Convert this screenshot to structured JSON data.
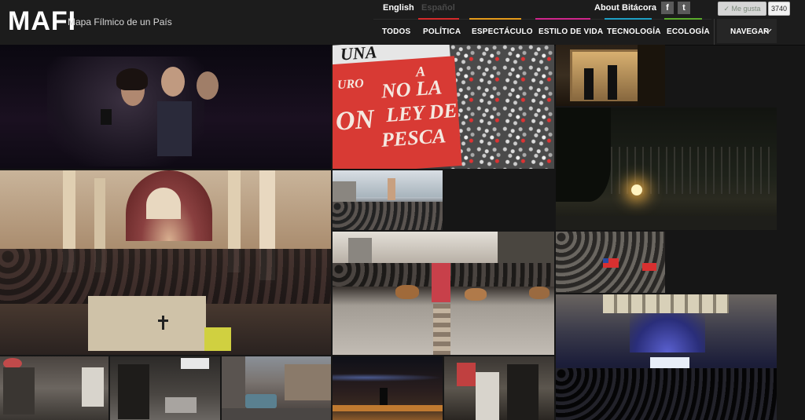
{
  "header": {
    "logo": "MAFI",
    "tagline": "Mapa Fílmico de un País",
    "lang_english": "English",
    "lang_spanish": "Español",
    "link_about": "About",
    "link_bitacora": "Bitácora",
    "facebook_glyph": "f",
    "twitter_glyph": "t",
    "like_label": "✓ Me gusta",
    "like_count": "3740"
  },
  "nav": {
    "items": [
      {
        "label": "TODOS",
        "color": "#1c1c1c"
      },
      {
        "label": "POLÍTICA",
        "color": "#d62a2a"
      },
      {
        "label": "ESPECTÁCULO",
        "color": "#e59a1a"
      },
      {
        "label": "ESTILO DE VIDA",
        "color": "#d0268c"
      },
      {
        "label": "TECNOLOGÍA",
        "color": "#1ea0c4"
      },
      {
        "label": "ECOLOGÍA",
        "color": "#5aab2c"
      }
    ],
    "browse": "NAVEGAR"
  },
  "banner_text": {
    "line1": "UNA",
    "line2": "A",
    "line3": "NO LA",
    "line4": "LEY DE",
    "line5": "PESCA",
    "side1": "URO",
    "side2": "ON"
  }
}
